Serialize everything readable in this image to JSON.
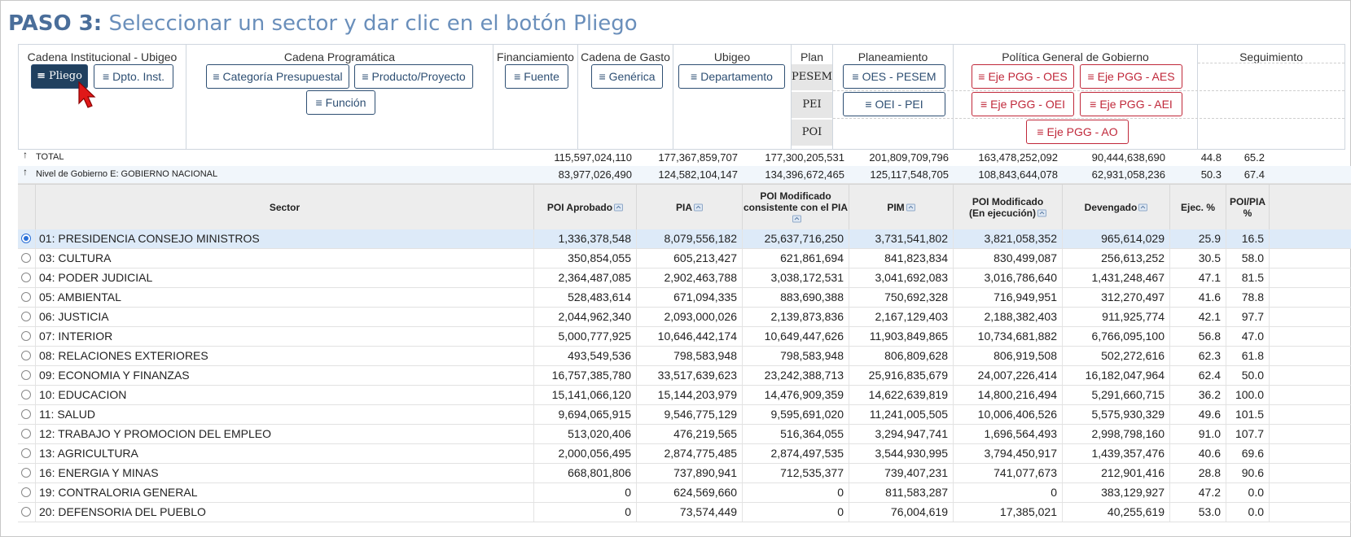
{
  "title": {
    "step": "PASO 3:",
    "text": "Seleccionar un sector y dar clic en el botón Pliego"
  },
  "filters": {
    "cadena_institucional": {
      "label": "Cadena Institucional - Ubigeo",
      "buttons": [
        "Pliego",
        "Dpto. Inst."
      ]
    },
    "cadena_programatica": {
      "label": "Cadena Programática",
      "buttons": [
        "Categoría Presupuestal",
        "Producto/Proyecto",
        "Función"
      ]
    },
    "financiamiento": {
      "label": "Financiamiento",
      "buttons": [
        "Fuente"
      ]
    },
    "cadena_gasto": {
      "label": "Cadena de Gasto",
      "buttons": [
        "Genérica"
      ]
    },
    "ubigeo": {
      "label": "Ubigeo",
      "buttons": [
        "Departamento"
      ]
    },
    "plan": {
      "label": "Plan",
      "rows": [
        "PESEM",
        "PEI",
        "POI"
      ]
    },
    "planeamiento": {
      "label": "Planeamiento",
      "buttons": [
        "OES - PESEM",
        "OEI - PEI"
      ]
    },
    "pgg": {
      "label": "Política General de Gobierno",
      "buttons": [
        "Eje PGG - OES",
        "Eje PGG - AES",
        "Eje PGG - OEI",
        "Eje PGG - AEI",
        "Eje PGG - AO"
      ]
    },
    "seguimiento": {
      "label": "Seguimiento"
    }
  },
  "totals": [
    {
      "label": "TOTAL",
      "values": [
        "115,597,024,110",
        "177,367,859,707",
        "177,300,205,531",
        "201,809,709,796",
        "163,478,252,092",
        "90,444,638,690",
        "44.8",
        "65.2"
      ]
    },
    {
      "label": "Nivel de Gobierno E: GOBIERNO NACIONAL",
      "values": [
        "83,977,026,490",
        "124,582,104,147",
        "134,396,672,465",
        "125,117,548,705",
        "108,843,644,078",
        "62,931,058,236",
        "50.3",
        "67.4"
      ]
    }
  ],
  "headers": [
    "Sector",
    "POI Aprobado",
    "PIA",
    "POI Modificado consistente con el PIA",
    "PIM",
    "POI Modificado (En ejecución)",
    "Devengado",
    "Ejec. %",
    "POI/PIA %"
  ],
  "header_lines": {
    "poi_mod_pia": [
      "POI Modificado",
      "consistente con el PIA"
    ],
    "poi_mod_ejec": [
      "POI Modificado",
      "(En ejecución)"
    ],
    "poi_pia": [
      "POI/PIA",
      "%"
    ]
  },
  "rows": [
    {
      "sector": "01: PRESIDENCIA CONSEJO MINISTROS",
      "selected": true,
      "values": [
        "1,336,378,548",
        "8,079,556,182",
        "25,637,716,250",
        "3,731,541,802",
        "3,821,058,352",
        "965,614,029",
        "25.9",
        "16.5"
      ]
    },
    {
      "sector": "03: CULTURA",
      "values": [
        "350,854,055",
        "605,213,427",
        "621,861,694",
        "841,823,834",
        "830,499,087",
        "256,613,252",
        "30.5",
        "58.0"
      ]
    },
    {
      "sector": "04: PODER JUDICIAL",
      "values": [
        "2,364,487,085",
        "2,902,463,788",
        "3,038,172,531",
        "3,041,692,083",
        "3,016,786,640",
        "1,431,248,467",
        "47.1",
        "81.5"
      ]
    },
    {
      "sector": "05: AMBIENTAL",
      "values": [
        "528,483,614",
        "671,094,335",
        "883,690,388",
        "750,692,328",
        "716,949,951",
        "312,270,497",
        "41.6",
        "78.8"
      ]
    },
    {
      "sector": "06: JUSTICIA",
      "values": [
        "2,044,962,340",
        "2,093,000,026",
        "2,139,873,836",
        "2,167,129,403",
        "2,188,382,403",
        "911,925,774",
        "42.1",
        "97.7"
      ]
    },
    {
      "sector": "07: INTERIOR",
      "values": [
        "5,000,777,925",
        "10,646,442,174",
        "10,649,447,626",
        "11,903,849,865",
        "10,734,681,882",
        "6,766,095,100",
        "56.8",
        "47.0"
      ]
    },
    {
      "sector": "08: RELACIONES EXTERIORES",
      "values": [
        "493,549,536",
        "798,583,948",
        "798,583,948",
        "806,809,628",
        "806,919,508",
        "502,272,616",
        "62.3",
        "61.8"
      ]
    },
    {
      "sector": "09: ECONOMIA Y FINANZAS",
      "values": [
        "16,757,385,780",
        "33,517,639,623",
        "23,242,388,713",
        "25,916,835,679",
        "24,007,226,414",
        "16,182,047,964",
        "62.4",
        "50.0"
      ]
    },
    {
      "sector": "10: EDUCACION",
      "values": [
        "15,141,066,120",
        "15,144,203,979",
        "14,476,909,359",
        "14,622,639,819",
        "14,800,216,494",
        "5,291,660,715",
        "36.2",
        "100.0"
      ]
    },
    {
      "sector": "11: SALUD",
      "values": [
        "9,694,065,915",
        "9,546,775,129",
        "9,595,691,020",
        "11,241,005,505",
        "10,006,406,526",
        "5,575,930,329",
        "49.6",
        "101.5"
      ]
    },
    {
      "sector": "12: TRABAJO Y PROMOCION DEL EMPLEO",
      "values": [
        "513,020,406",
        "476,219,565",
        "516,364,055",
        "3,294,947,741",
        "1,696,564,493",
        "2,998,798,160",
        "91.0",
        "107.7"
      ]
    },
    {
      "sector": "13: AGRICULTURA",
      "values": [
        "2,000,056,495",
        "2,874,775,485",
        "2,874,497,535",
        "3,544,930,995",
        "3,794,450,917",
        "1,439,357,476",
        "40.6",
        "69.6"
      ]
    },
    {
      "sector": "16: ENERGIA Y MINAS",
      "values": [
        "668,801,806",
        "737,890,941",
        "712,535,377",
        "739,407,231",
        "741,077,673",
        "212,901,416",
        "28.8",
        "90.6"
      ]
    },
    {
      "sector": "19: CONTRALORIA GENERAL",
      "values": [
        "0",
        "624,569,660",
        "0",
        "811,583,287",
        "0",
        "383,129,927",
        "47.2",
        "0.0"
      ]
    },
    {
      "sector": "20: DEFENSORIA DEL PUEBLO",
      "values": [
        "0",
        "73,574,449",
        "0",
        "76,004,619",
        "17,385,021",
        "40,255,619",
        "53.0",
        "0.0"
      ]
    }
  ]
}
